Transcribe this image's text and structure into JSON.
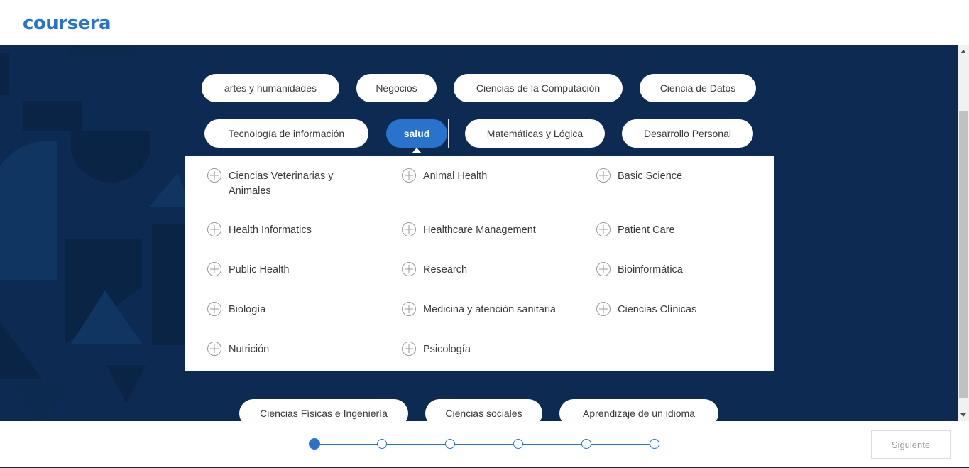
{
  "header": {
    "logo_text": "coursera"
  },
  "topics_row1": [
    {
      "label": "artes y humanidades"
    },
    {
      "label": "Negocios"
    },
    {
      "label": "Ciencias de la Computación"
    },
    {
      "label": "Ciencia de Datos"
    }
  ],
  "topics_row2": [
    {
      "label": "Tecnología de información"
    },
    {
      "label": "salud",
      "selected": true
    },
    {
      "label": "Matemáticas y Lógica"
    },
    {
      "label": "Desarrollo Personal"
    }
  ],
  "subtopics": [
    "Ciencias Veterinarias y Animales",
    "Animal Health",
    "Basic Science",
    "Health Informatics",
    "Healthcare Management",
    "Patient Care",
    "Public Health",
    "Research",
    "Bioinformática",
    "Biología",
    "Medicina y atención sanitaria",
    "Ciencias Clínicas",
    "Nutrición",
    "Psicología"
  ],
  "topics_row3": [
    {
      "label": "Ciencias Físicas e Ingeniería"
    },
    {
      "label": "Ciencias sociales"
    },
    {
      "label": "Aprendizaje de un idioma"
    }
  ],
  "stepper": {
    "total_steps": 6,
    "current_step": 1
  },
  "footer": {
    "next_label": "Siguiente"
  },
  "colors": {
    "navy": "#0d2b52",
    "brand_blue": "#2a73cc"
  }
}
